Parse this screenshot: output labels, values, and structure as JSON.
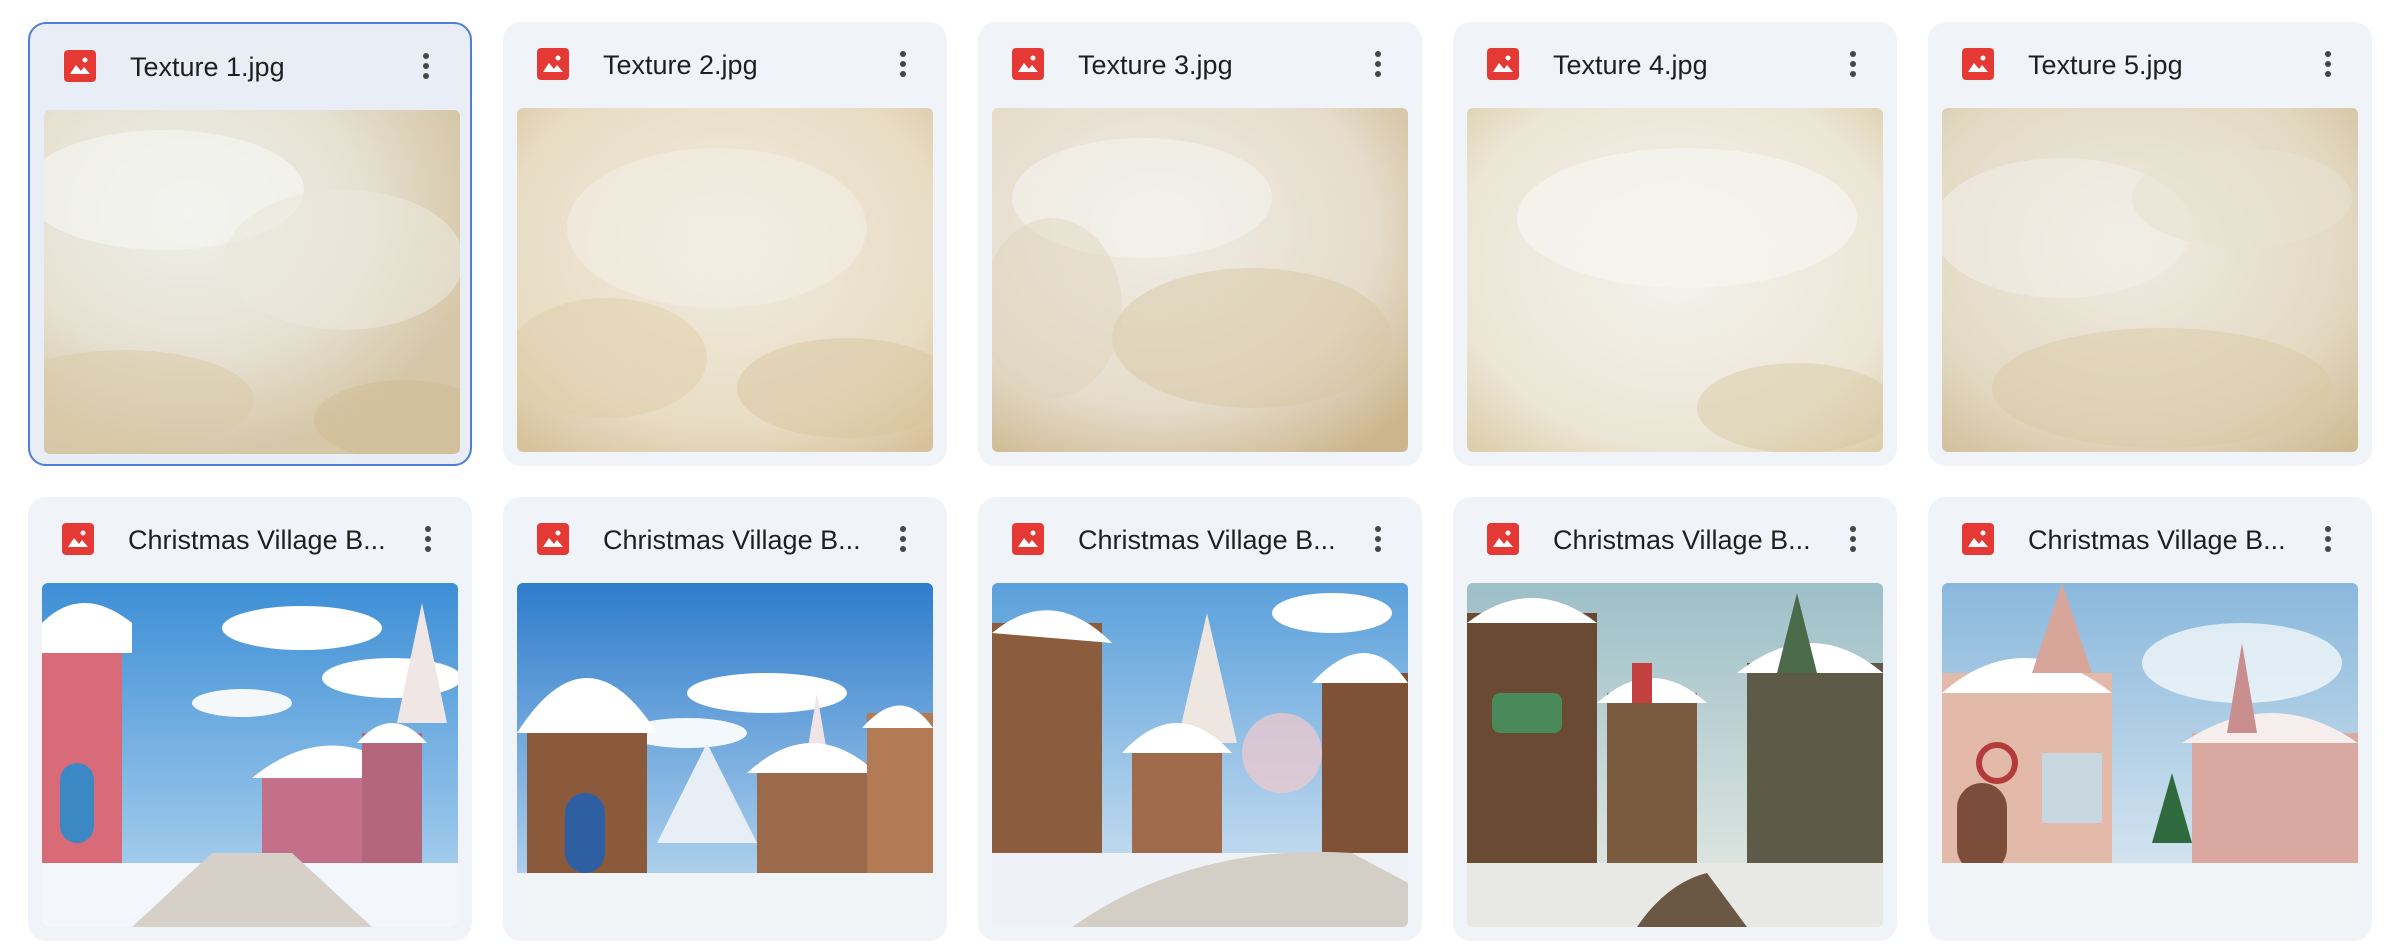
{
  "file_grid": {
    "files": [
      {
        "name": "Texture 1.jpg",
        "icon": "image-file-icon",
        "kind": "texture",
        "selected": true
      },
      {
        "name": "Texture 2.jpg",
        "icon": "image-file-icon",
        "kind": "texture",
        "selected": false
      },
      {
        "name": "Texture 3.jpg",
        "icon": "image-file-icon",
        "kind": "texture",
        "selected": false
      },
      {
        "name": "Texture 4.jpg",
        "icon": "image-file-icon",
        "kind": "texture",
        "selected": false
      },
      {
        "name": "Texture 5.jpg",
        "icon": "image-file-icon",
        "kind": "texture",
        "selected": false
      },
      {
        "name": "Christmas Village B...",
        "icon": "image-file-icon",
        "kind": "village",
        "selected": false
      },
      {
        "name": "Christmas Village B...",
        "icon": "image-file-icon",
        "kind": "village",
        "selected": false
      },
      {
        "name": "Christmas Village B...",
        "icon": "image-file-icon",
        "kind": "village",
        "selected": false
      },
      {
        "name": "Christmas Village B...",
        "icon": "image-file-icon",
        "kind": "village",
        "selected": false
      },
      {
        "name": "Christmas Village B...",
        "icon": "image-file-icon",
        "kind": "village",
        "selected": false
      }
    ],
    "more_icon": "more-vert-icon",
    "colors": {
      "file_icon": "#e53935",
      "card_bg": "#f0f4f9",
      "selected_border": "#4f7ddb"
    }
  }
}
